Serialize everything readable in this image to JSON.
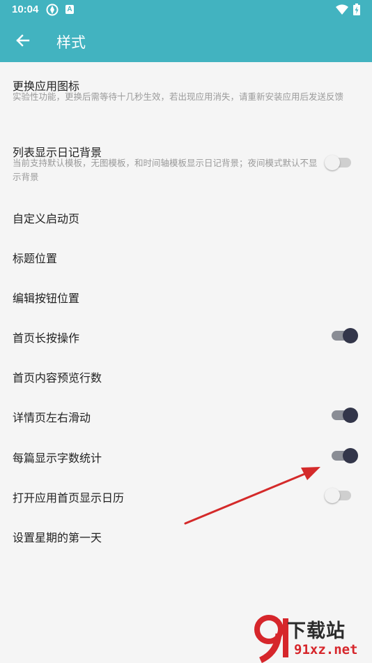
{
  "status_bar": {
    "time": "10:04",
    "notification_icon_letter": "A"
  },
  "toolbar": {
    "title": "样式",
    "back_icon": "arrow-left-icon"
  },
  "settings": [
    {
      "title": "更换应用图标",
      "subtitle": "实验性功能，更换后需等待十几秒生效，若出现应用消失，请重新安装应用后发送反馈"
    },
    {
      "title": "列表显示日记背景",
      "subtitle": "当前支持默认模板，无图模板，和时间轴模板显示日记背景；夜间模式默认不显示背景",
      "toggle": false
    },
    {
      "title": "自定义启动页"
    },
    {
      "title": "标题位置"
    },
    {
      "title": "编辑按钮位置"
    },
    {
      "title": "首页长按操作",
      "toggle": true
    },
    {
      "title": "首页内容预览行数"
    },
    {
      "title": "详情页左右滑动",
      "toggle": true
    },
    {
      "title": "每篇显示字数统计",
      "toggle": true
    },
    {
      "title": "打开应用首页显示日历",
      "toggle": false
    },
    {
      "title": "设置星期的第一天"
    }
  ],
  "watermark": {
    "brand": "下载站",
    "site": "91xz.net"
  },
  "colors": {
    "primary": "#42b3c0",
    "toggle_on": "#33364a",
    "arrow": "#d42a2a"
  }
}
